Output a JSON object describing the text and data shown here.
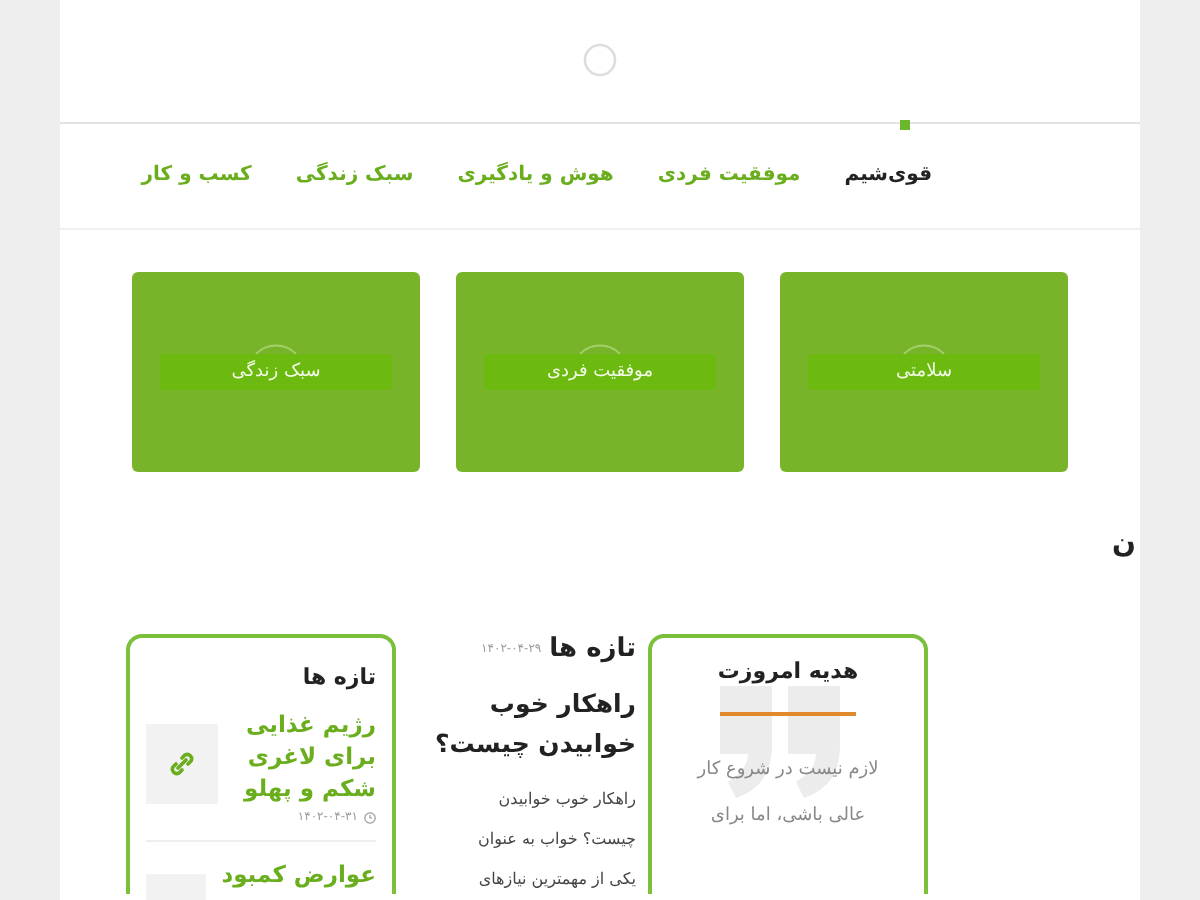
{
  "nav": {
    "items": [
      {
        "label": "قوی‌شیم",
        "selected": true
      },
      {
        "label": "موفقیت فردی",
        "selected": false
      },
      {
        "label": "هوش و یادگیری",
        "selected": false
      },
      {
        "label": "سبک زندگی",
        "selected": false
      },
      {
        "label": "کسب و کار",
        "selected": false
      }
    ]
  },
  "categories": [
    {
      "label": "سلامتی"
    },
    {
      "label": "موفقیت فردی"
    },
    {
      "label": "سبک زندگی"
    }
  ],
  "section_heading": "ن",
  "gift": {
    "title": "هدیه امروزت",
    "lines": [
      "لازم نیست در شروع کار",
      "عالی باشی، اما برای"
    ]
  },
  "featured": {
    "heading": "تازه ها",
    "date": "۱۴۰۲-۰۴-۲۹",
    "title": "راهکار خوب خوابیدن چیست؟",
    "excerpt_lines": [
      "راهکار خوب خوابیدن",
      "چیست؟ خواب به عنوان",
      "یکی از مهمترین نیازهای"
    ]
  },
  "recent": {
    "title": "تازه ها",
    "posts": [
      {
        "title": "رژیم غذایی برای لاغری شکم و پهلو",
        "date": "۱۴۰۲-۰۴-۳۱"
      },
      {
        "title": "عوارض کمبود"
      }
    ]
  }
}
